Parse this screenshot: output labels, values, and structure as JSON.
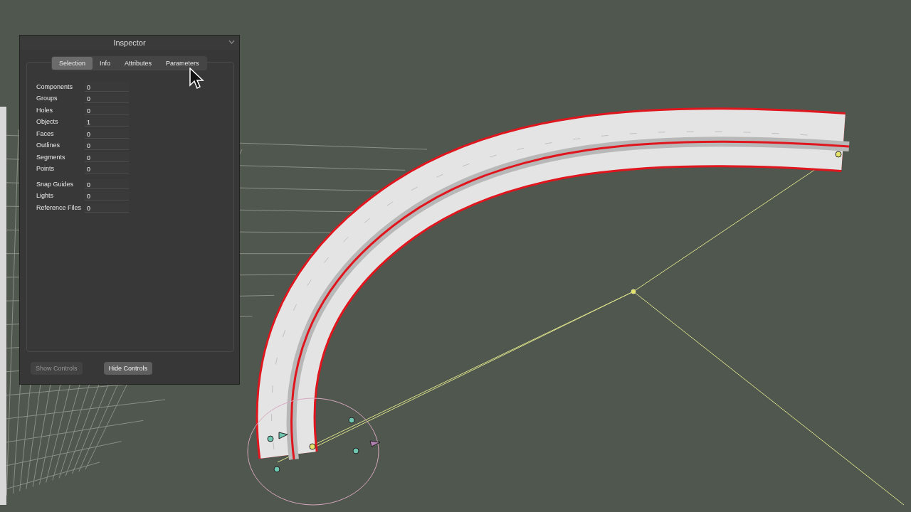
{
  "window": {
    "title": "Inspector"
  },
  "tabs": [
    {
      "label": "Selection",
      "selected": true
    },
    {
      "label": "Info",
      "selected": false
    },
    {
      "label": "Attributes",
      "selected": false
    },
    {
      "label": "Parameters",
      "selected": false
    }
  ],
  "groups": [
    {
      "rows": [
        {
          "label": "Components",
          "value": "0"
        },
        {
          "label": "Groups",
          "value": "0"
        },
        {
          "label": "Holes",
          "value": "0"
        },
        {
          "label": "Objects",
          "value": "1"
        },
        {
          "label": "Faces",
          "value": "0"
        },
        {
          "label": "Outlines",
          "value": "0"
        },
        {
          "label": "Segments",
          "value": "0"
        },
        {
          "label": "Points",
          "value": "0"
        }
      ]
    },
    {
      "rows": [
        {
          "label": "Snap Guides",
          "value": "0"
        },
        {
          "label": "Lights",
          "value": "0"
        },
        {
          "label": "Reference Files",
          "value": "0"
        }
      ]
    }
  ],
  "buttons": [
    {
      "label": "Show Controls",
      "disabled": true
    },
    {
      "label": "Hide Controls",
      "disabled": false
    }
  ]
}
